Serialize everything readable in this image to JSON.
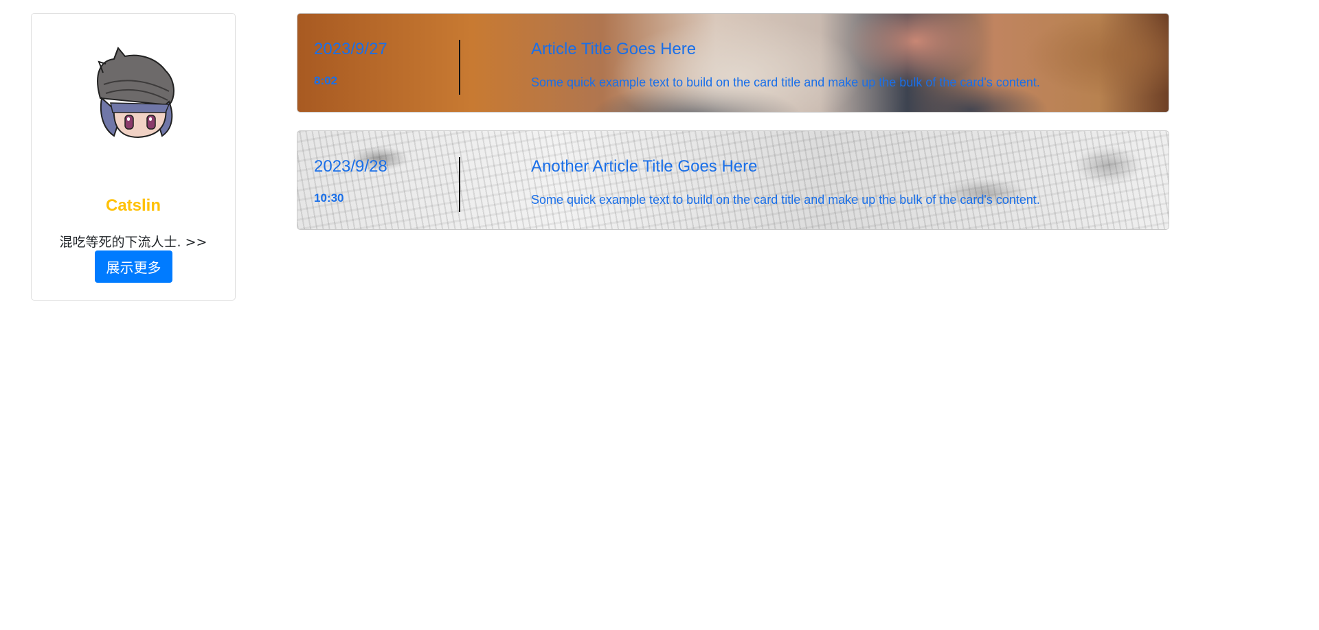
{
  "profile": {
    "name": "Catslin",
    "bio": "混吃等死的下流人士. >>",
    "more_button_label": "展示更多"
  },
  "articles": [
    {
      "date": "2023/9/27",
      "time": "8:02",
      "title": "Article Title Goes Here",
      "text": "Some quick example text to build on the card title and make up the bulk of the card's content."
    },
    {
      "date": "2023/9/28",
      "time": "10:30",
      "title": "Another Article Title Goes Here",
      "text": "Some quick example text to build on the card title and make up the bulk of the card's content."
    }
  ],
  "colors": {
    "accent": "#007bff",
    "name": "#ffc107",
    "link_text": "#1a6fe8"
  }
}
